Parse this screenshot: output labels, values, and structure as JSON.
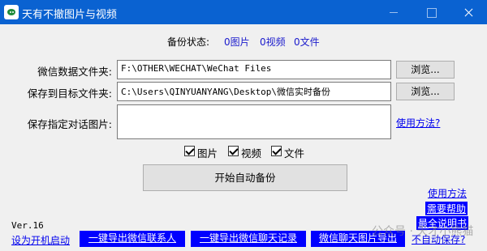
{
  "window": {
    "title": "天有不撤图片与视频"
  },
  "status": {
    "label": "备份状态:",
    "images": "0图片",
    "videos": "0视频",
    "files": "0文件"
  },
  "wechat_folder": {
    "label": "微信数据文件夹:",
    "value": "F:\\OTHER\\WECHAT\\WeChat Files",
    "browse_label": "浏览..."
  },
  "target_folder": {
    "label": "保存到目标文件夹:",
    "value": "C:\\Users\\QINYUANYANG\\Desktop\\微信实时备份",
    "browse_label": "浏览..."
  },
  "dialog_images": {
    "label": "保存指定对话图片:",
    "value": "",
    "help_link": "使用方法?"
  },
  "options": [
    {
      "label": "图片",
      "checked": true
    },
    {
      "label": "视频",
      "checked": true
    },
    {
      "label": "文件",
      "checked": true
    }
  ],
  "start_button": "开始自动备份",
  "right_links": {
    "usage": "使用方法",
    "need_help": "需要帮助",
    "full_manual": "最全说明书",
    "not_auto_save": "不自动保存?"
  },
  "version": "Ver.16",
  "bottom": {
    "autostart": "设为开机启动",
    "export_contacts": "一键导出微信联系人",
    "export_chats": "一键导出微信聊天记录",
    "export_chat_images": "微信聊天图片导出"
  },
  "watermark": "公众号 · 天才小熊猫"
}
